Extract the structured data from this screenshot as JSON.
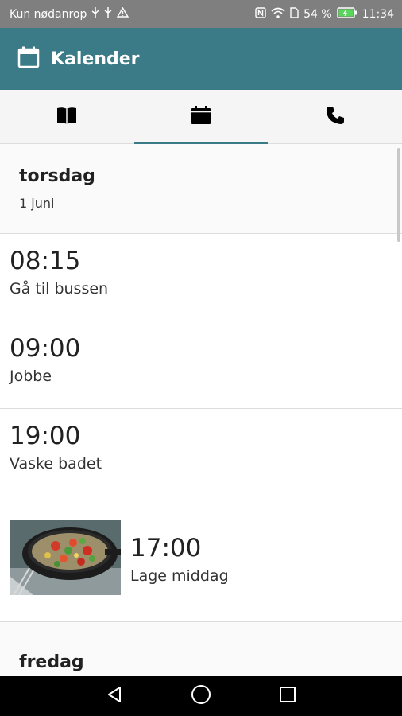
{
  "status_bar": {
    "carrier": "Kun nødanrop",
    "battery": "54 %",
    "time": "11:34"
  },
  "app_bar": {
    "title": "Kalender",
    "icon": "calendar-icon"
  },
  "tabs": [
    {
      "icon": "book-icon"
    },
    {
      "icon": "calendar-icon",
      "active": true
    },
    {
      "icon": "phone-icon"
    }
  ],
  "days": [
    {
      "name": "torsdag",
      "date": "1 juni",
      "events": [
        {
          "time": "08:15",
          "label": "Gå til bussen"
        },
        {
          "time": "09:00",
          "label": "Jobbe"
        },
        {
          "time": "19:00",
          "label": "Vaske badet"
        },
        {
          "time": "17:00",
          "label": "Lage middag",
          "image": "food-pan-photo"
        }
      ]
    },
    {
      "name": "fredag"
    }
  ],
  "nav_bar": [
    "back-icon",
    "home-icon",
    "recents-icon"
  ],
  "colors": {
    "app_bar": "#3b7a87",
    "status_bar": "#7f7f7f",
    "tab_indicator": "#3b7a87"
  }
}
